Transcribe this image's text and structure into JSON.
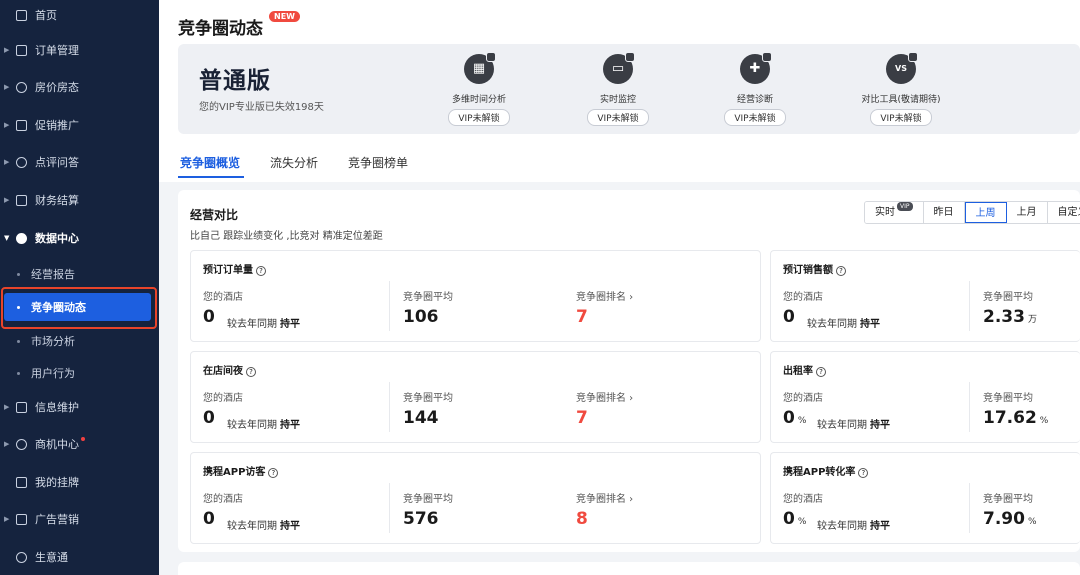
{
  "sidebar": {
    "items": [
      {
        "label": "首页"
      },
      {
        "label": "订单管理"
      },
      {
        "label": "房价房态"
      },
      {
        "label": "促销推广"
      },
      {
        "label": "点评问答"
      },
      {
        "label": "财务结算"
      },
      {
        "label": "数据中心"
      },
      {
        "label": "信息维护"
      },
      {
        "label": "商机中心"
      },
      {
        "label": "我的挂牌"
      },
      {
        "label": "广告营销"
      },
      {
        "label": "生意通"
      }
    ],
    "sub_items": [
      {
        "label": "经营报告"
      },
      {
        "label": "竞争圈动态"
      },
      {
        "label": "市场分析"
      },
      {
        "label": "用户行为"
      }
    ]
  },
  "header": {
    "title": "竞争圈动态",
    "badge": "NEW"
  },
  "banner": {
    "edition": "普通版",
    "subtitle": "您的VIP专业版已失效198天",
    "features": [
      {
        "name": "多维时间分析",
        "tag": "VIP未解锁",
        "icon": "calendar-icon"
      },
      {
        "name": "实时监控",
        "tag": "VIP未解锁",
        "icon": "monitor-icon"
      },
      {
        "name": "经营诊断",
        "tag": "VIP未解锁",
        "icon": "medkit-icon"
      },
      {
        "name": "对比工具(敬请期待)",
        "tag": "VIP未解锁",
        "icon": "vs-icon",
        "icon_text": "VS"
      }
    ]
  },
  "tabs": [
    {
      "label": "竞争圈概览"
    },
    {
      "label": "流失分析"
    },
    {
      "label": "竞争圈榜单"
    }
  ],
  "section": {
    "title": "经营对比",
    "subtitle": "比自己 跟踪业绩变化 ,比竞对 精准定位差距",
    "periods": [
      {
        "label": "实时",
        "vip": "VIP"
      },
      {
        "label": "昨日"
      },
      {
        "label": "上周"
      },
      {
        "label": "上月"
      },
      {
        "label": "自定义"
      }
    ],
    "selected_period": "上周"
  },
  "labels": {
    "your_hotel": "您的酒店",
    "circle_avg": "竞争圈平均",
    "circle_rank": "竞争圈排名 ›",
    "yoy": "较去年同期",
    "flat": "持平",
    "help": "?"
  },
  "metrics_left": [
    {
      "title": "预订订单量",
      "yours": "0",
      "avg": "106",
      "rank": "7"
    },
    {
      "title": "在店间夜",
      "yours": "0",
      "avg": "144",
      "rank": "7"
    },
    {
      "title": "携程APP访客",
      "yours": "0",
      "avg": "576",
      "rank": "8"
    }
  ],
  "metrics_right": [
    {
      "title": "预订销售额",
      "yours": "0",
      "yours_unit": "",
      "avg": "2.33",
      "avg_unit": "万"
    },
    {
      "title": "出租率",
      "yours": "0",
      "yours_unit": "%",
      "avg": "17.62",
      "avg_unit": "%"
    },
    {
      "title": "携程APP转化率",
      "yours": "0",
      "yours_unit": "%",
      "avg": "7.90",
      "avg_unit": "%"
    }
  ],
  "colors": {
    "sidebar_bg": "#15233e",
    "accent": "#1d5fe0",
    "rank_red": "#f04a3f",
    "highlight": "#e8442a"
  }
}
